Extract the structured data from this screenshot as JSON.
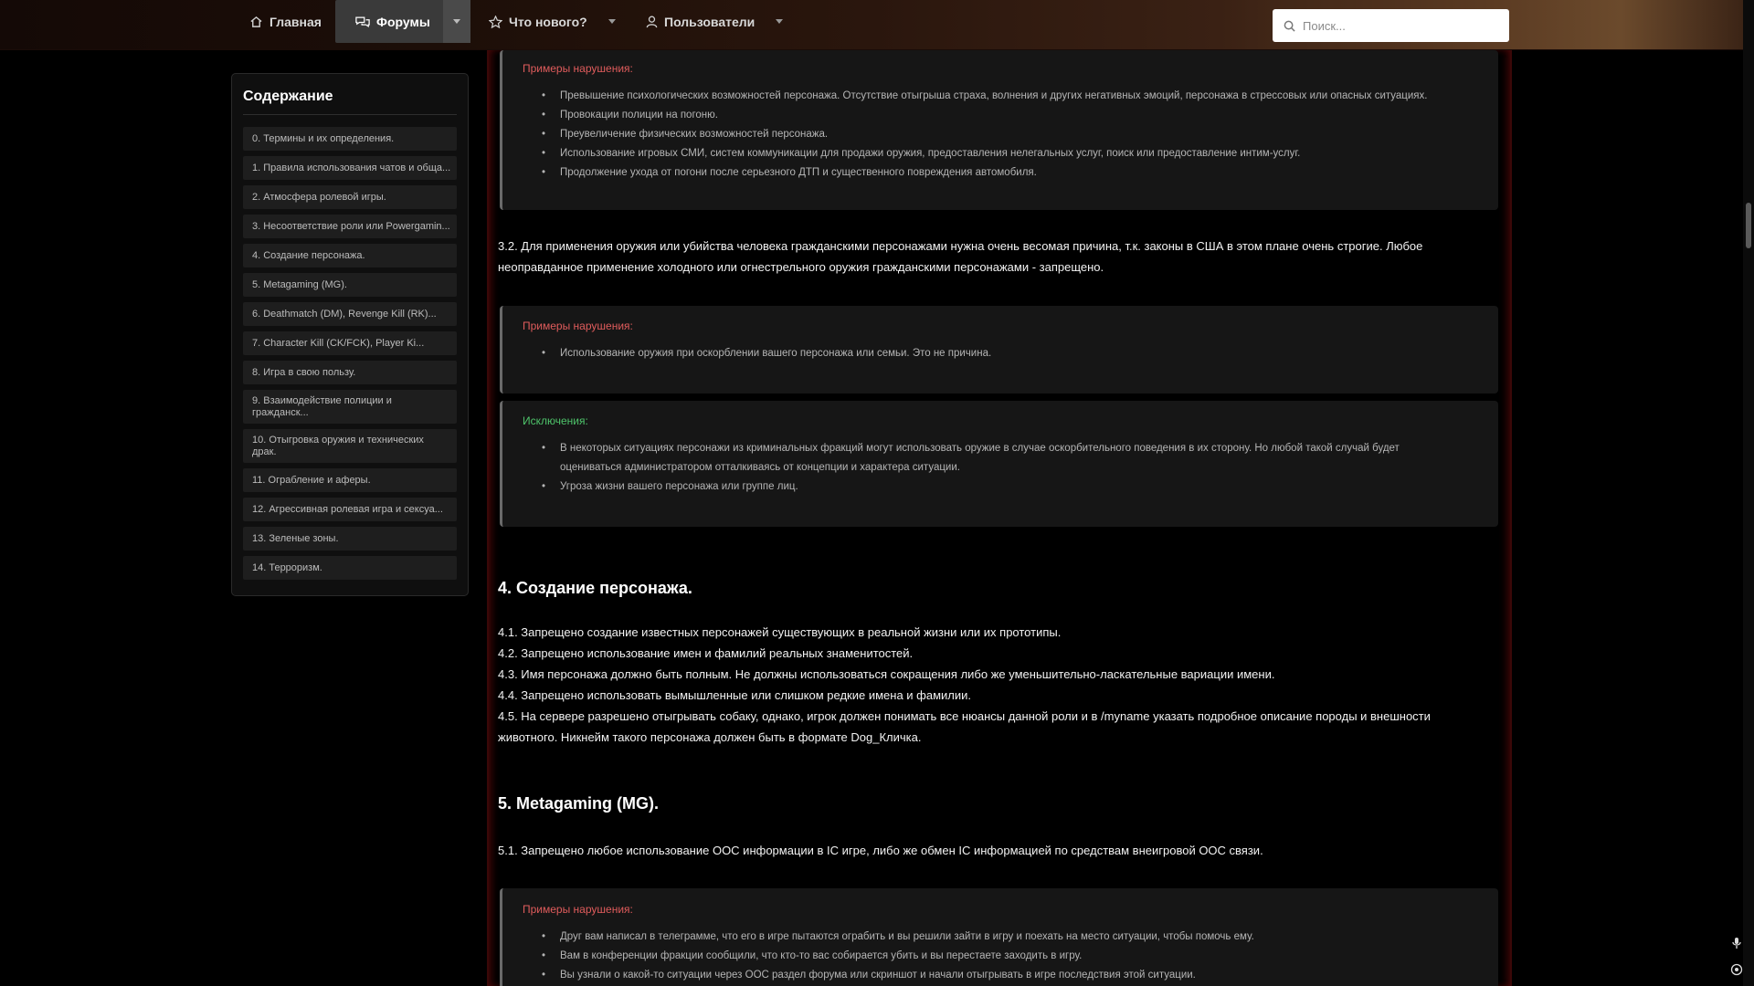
{
  "nav": {
    "home": "Главная",
    "forums": "Форумы",
    "whats_new": "Что нового?",
    "users": "Пользователи",
    "search_placeholder": "Поиск..."
  },
  "toc": {
    "title": "Содержание",
    "items": [
      "0. Термины и их определения.",
      "1. Правила использования чатов и обща...",
      "2. Атмосфера ролевой игры.",
      "3. Несоответствие роли или Powergamin...",
      "4. Создание персонажа.",
      "5. Metagaming (MG).",
      "6. Deathmatch (DM), Revenge Kill (RK)...",
      "7. Character Kill (CK/FCK), Player Ki...",
      "8. Игра в свою пользу.",
      "9. Взаимодействие полиции и гражданск...",
      "10. Отыгровка оружия и технических драк.",
      "11. Ограбление и аферы.",
      "12. Агрессивная ролевая игра и сексуа...",
      "13. Зеленые зоны.",
      "14. Терроризм."
    ]
  },
  "content": {
    "box1": {
      "title": "Примеры нарушения:",
      "items": [
        "Превышение психологических возможностей персонажа. Отсутствие отыгрыша страха, волнения и других негативных эмоций, персонажа в стрессовых или опасных ситуациях.",
        "Провокации полиции на погоню.",
        "Преувеличение физических возможностей персонажа.",
        "Использование игровых СМИ, систем коммуникации для продажи оружия, предоставления нелегальных услуг, поиск или предоставление интим-услуг.",
        "Продолжение ухода от погони после серьезного ДТП и существенного повреждения автомобиля."
      ]
    },
    "p32_line1": "3.2. Для применения оружия или убийства человека гражданскими персонажами нужна очень весомая причина, т.к. законы в США в этом плане очень строгие. Любое",
    "p32_line2": "неоправданное применение холодного или огнестрельного оружия гражданскими персонажами - запрещено.",
    "box2": {
      "title": "Примеры нарушения:",
      "items": [
        "Использование оружия при оскорблении вашего персонажа или семьи. Это не причина."
      ]
    },
    "box3": {
      "title": "Исключения:",
      "item1_line1": "В некоторых ситуациях персонажи из криминальных фракций могут использовать оружие в случае оскорбительного поведения в их сторону. Но любой такой случай будет",
      "item1_line2": "оцениваться администратором отталкиваясь от концепции и характера ситуации.",
      "item2": "Угроза жизни вашего персонажа или группе лиц."
    },
    "h4": "4. Создание персонажа.",
    "p41": "4.1. Запрещено создание известных персонажей существующих в реальной жизни или их прототипы.",
    "p42": "4.2. Запрещено использование имен и фамилий реальных знаменитостей.",
    "p43": "4.3. Имя персонажа должно быть полным. Не должны использоваться сокращения либо же уменьшительно-ласкательные вариации имени.",
    "p44": "4.4. Запрещено использовать вымышленные или слишком редкие имена и фамилии.",
    "p45_line1": "4.5. На сервере разрешено отыгрывать собаку, однако, игрок должен понимать все нюансы данной роли и в /myname указать подробное описание породы и внешности",
    "p45_line2": "животного. Никнейм такого персонажа должен быть в формате Dog_Кличка.",
    "h5": "5. Metagaming (MG).",
    "p51": "5.1. Запрещено любое использование ООС информации в IC игре, либо же обмен IC информацией по средствам внеигровой ООС связи.",
    "box4": {
      "title": "Примеры нарушения:",
      "items": [
        "Друг вам написал в телеграмме, что его в игре пытаются ограбить и вы решили зайти в игру и поехать на место ситуации, чтобы помочь ему.",
        "Вам в конференции фракции сообщили, что кто-то вас собирается убить и вы перестаете заходить в игру.",
        "Вы узнали о какой-то ситуации через ООС раздел форума или скриншот и начали отыгрывать в игре последствия этой ситуации."
      ]
    }
  }
}
